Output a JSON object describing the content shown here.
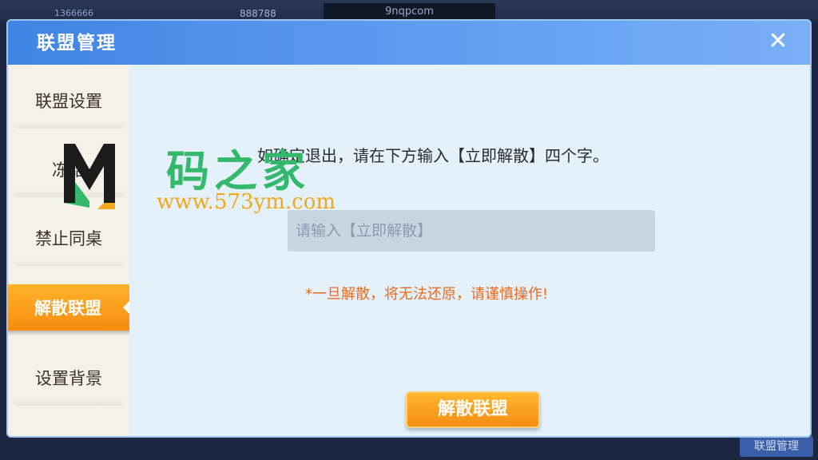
{
  "background": {
    "player_id": "1366666",
    "coins": "888788",
    "room_code": "9nqpcom",
    "bottom_button": "联盟管理"
  },
  "modal": {
    "title": "联盟管理",
    "close_icon": "close-icon"
  },
  "sidebar": {
    "items": [
      {
        "label": "联盟设置",
        "active": false
      },
      {
        "label": "冻结",
        "active": false
      },
      {
        "label": "禁止同桌",
        "active": false
      },
      {
        "label": "解散联盟",
        "active": true
      },
      {
        "label": "设置背景",
        "active": false
      }
    ]
  },
  "content": {
    "instruction": "如确定退出，请在下方输入【立即解散】四个字。",
    "input": {
      "value": "",
      "placeholder": "请输入【立即解散】"
    },
    "warning": "*一旦解散，将无法还原，请谨慎操作!",
    "confirm_label": "解散联盟"
  },
  "watermark": {
    "text": "码之家",
    "url": "www.573ym.com"
  },
  "colors": {
    "header": "#4a8ee8",
    "accent_orange": "#f78d0e",
    "warning": "#ee6a1c",
    "sidebar_bg": "#f4f1e8",
    "content_bg": "#e4f1fb"
  }
}
